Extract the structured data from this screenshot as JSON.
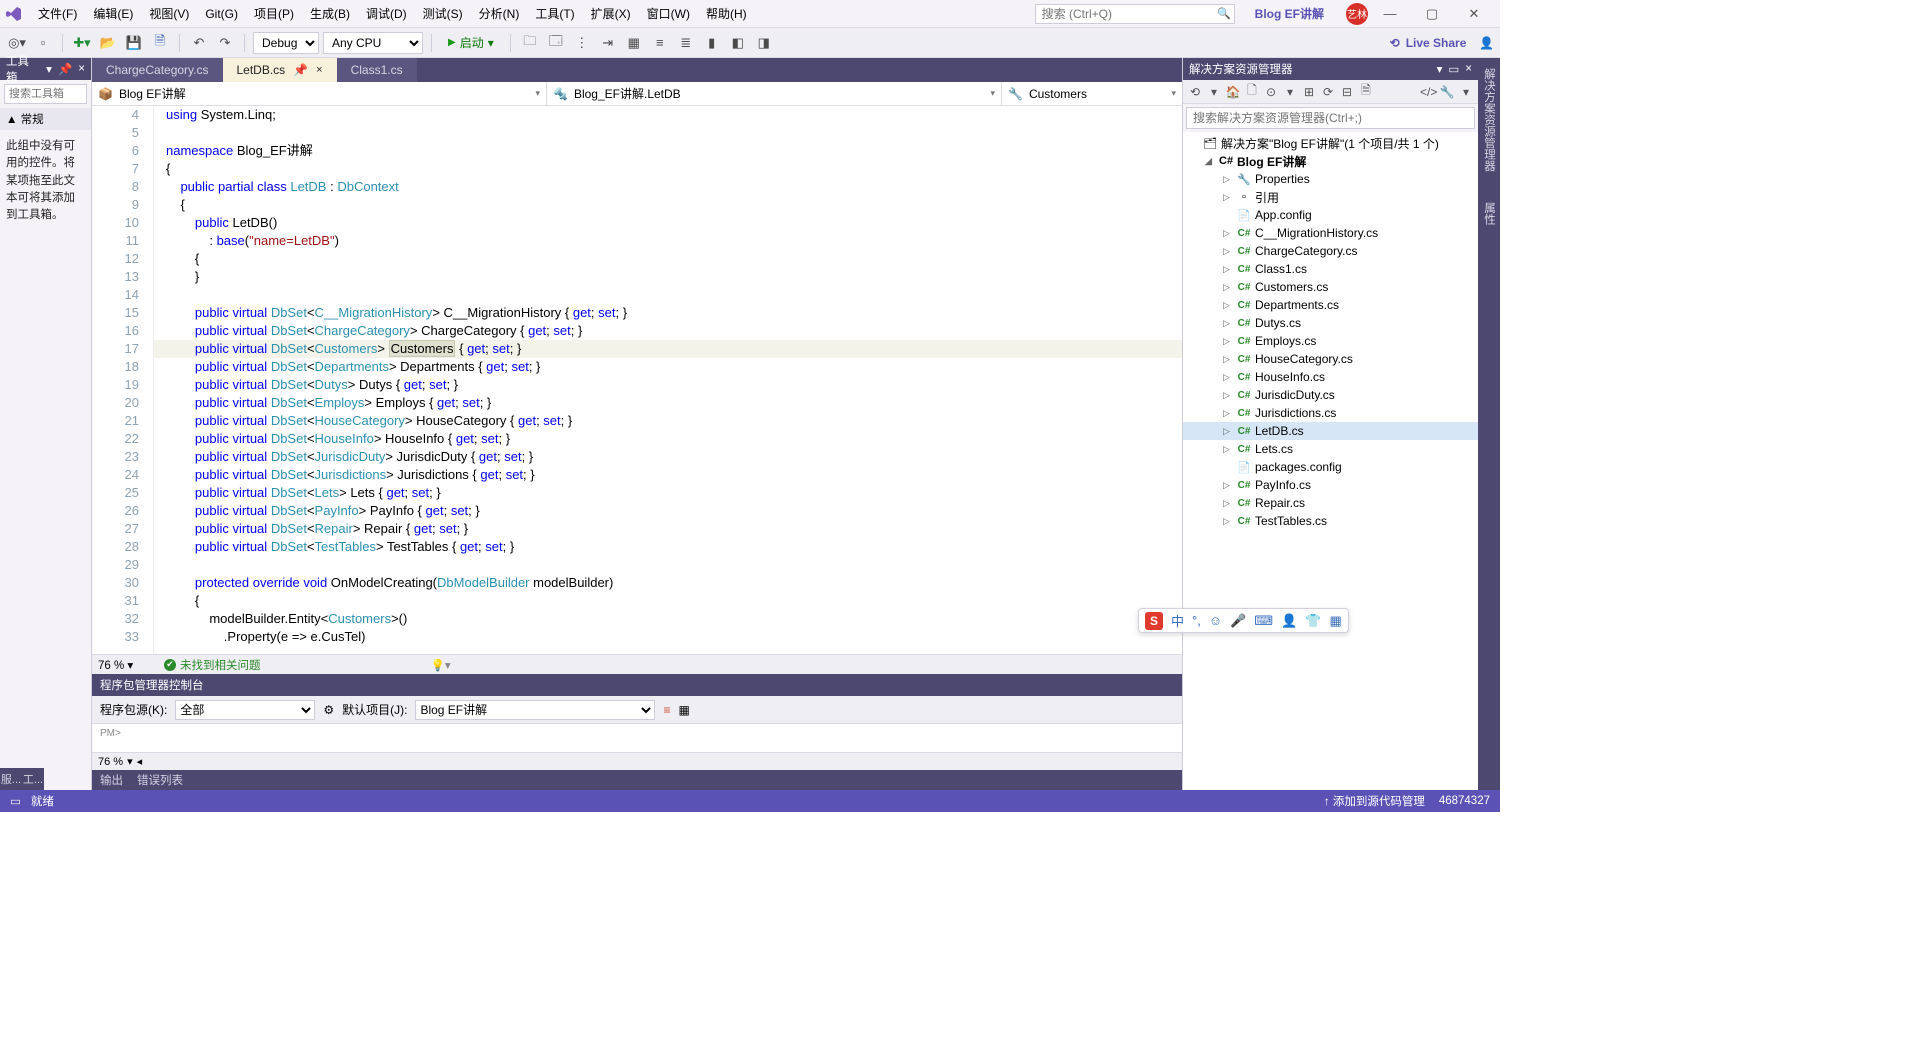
{
  "menu": {
    "items": [
      "文件(F)",
      "编辑(E)",
      "视图(V)",
      "Git(G)",
      "项目(P)",
      "生成(B)",
      "调试(D)",
      "测试(S)",
      "分析(N)",
      "工具(T)",
      "扩展(X)",
      "窗口(W)",
      "帮助(H)"
    ],
    "searchPlaceholder": "搜索 (Ctrl+Q)",
    "link": "Blog EF讲解",
    "avatar": "艺林"
  },
  "toolbar": {
    "config": "Debug",
    "platform": "Any CPU",
    "start": "启动",
    "liveshare": "Live Share"
  },
  "toolbox": {
    "title": "工具箱",
    "pin": "📌",
    "close": "×",
    "searchPlaceholder": "搜索工具箱",
    "cat": "▲ 常规",
    "msg": "此组中没有可用的控件。将某项拖至此文本可将其添加到工具箱。",
    "bottomTabs": [
      "服...",
      "工..."
    ]
  },
  "tabs": [
    {
      "label": "ChargeCategory.cs",
      "active": false
    },
    {
      "label": "LetDB.cs",
      "active": true
    },
    {
      "label": "Class1.cs",
      "active": false
    }
  ],
  "nav": {
    "left": "Blog EF讲解",
    "mid": "Blog_EF讲解.LetDB",
    "right": "Customers",
    "midIcon": "🔩",
    "rightIcon": "🔧"
  },
  "code": {
    "start": 4,
    "lines": [
      {
        "n": 4,
        "t": "using System.Linq;",
        "kw": [
          "using"
        ]
      },
      {
        "n": 5,
        "t": ""
      },
      {
        "n": 6,
        "t": "namespace Blog_EF讲解",
        "kw": [
          "namespace"
        ]
      },
      {
        "n": 7,
        "t": "{"
      },
      {
        "n": 8,
        "t": "    public partial class LetDB : DbContext",
        "kw": [
          "public",
          "partial",
          "class"
        ],
        "typ": [
          "LetDB",
          "DbContext"
        ]
      },
      {
        "n": 9,
        "t": "    {"
      },
      {
        "n": 10,
        "t": "        public LetDB()",
        "kw": [
          "public"
        ]
      },
      {
        "n": 11,
        "t": "            : base(\"name=LetDB\")",
        "kw": [
          "base"
        ],
        "str": [
          "\"name=LetDB\""
        ]
      },
      {
        "n": 12,
        "t": "        {"
      },
      {
        "n": 13,
        "t": "        }"
      },
      {
        "n": 14,
        "t": ""
      },
      {
        "n": 15,
        "t": "        public virtual DbSet<C__MigrationHistory> C__MigrationHistory { get; set; }",
        "kw": [
          "public",
          "virtual",
          "get",
          "set"
        ],
        "typ": [
          "DbSet",
          "C__MigrationHistory"
        ]
      },
      {
        "n": 16,
        "t": "        public virtual DbSet<ChargeCategory> ChargeCategory { get; set; }",
        "kw": [
          "public",
          "virtual",
          "get",
          "set"
        ],
        "typ": [
          "DbSet",
          "ChargeCategory"
        ]
      },
      {
        "n": 17,
        "t": "        public virtual DbSet<Customers> Customers { get; set; }",
        "kw": [
          "public",
          "virtual",
          "get",
          "set"
        ],
        "typ": [
          "DbSet",
          "Customers"
        ],
        "cur": true,
        "hl": "Customers"
      },
      {
        "n": 18,
        "t": "        public virtual DbSet<Departments> Departments { get; set; }",
        "kw": [
          "public",
          "virtual",
          "get",
          "set"
        ],
        "typ": [
          "DbSet",
          "Departments"
        ]
      },
      {
        "n": 19,
        "t": "        public virtual DbSet<Dutys> Dutys { get; set; }",
        "kw": [
          "public",
          "virtual",
          "get",
          "set"
        ],
        "typ": [
          "DbSet",
          "Dutys"
        ]
      },
      {
        "n": 20,
        "t": "        public virtual DbSet<Employs> Employs { get; set; }",
        "kw": [
          "public",
          "virtual",
          "get",
          "set"
        ],
        "typ": [
          "DbSet",
          "Employs"
        ]
      },
      {
        "n": 21,
        "t": "        public virtual DbSet<HouseCategory> HouseCategory { get; set; }",
        "kw": [
          "public",
          "virtual",
          "get",
          "set"
        ],
        "typ": [
          "DbSet",
          "HouseCategory"
        ]
      },
      {
        "n": 22,
        "t": "        public virtual DbSet<HouseInfo> HouseInfo { get; set; }",
        "kw": [
          "public",
          "virtual",
          "get",
          "set"
        ],
        "typ": [
          "DbSet",
          "HouseInfo"
        ]
      },
      {
        "n": 23,
        "t": "        public virtual DbSet<JurisdicDuty> JurisdicDuty { get; set; }",
        "kw": [
          "public",
          "virtual",
          "get",
          "set"
        ],
        "typ": [
          "DbSet",
          "JurisdicDuty"
        ]
      },
      {
        "n": 24,
        "t": "        public virtual DbSet<Jurisdictions> Jurisdictions { get; set; }",
        "kw": [
          "public",
          "virtual",
          "get",
          "set"
        ],
        "typ": [
          "DbSet",
          "Jurisdictions"
        ]
      },
      {
        "n": 25,
        "t": "        public virtual DbSet<Lets> Lets { get; set; }",
        "kw": [
          "public",
          "virtual",
          "get",
          "set"
        ],
        "typ": [
          "DbSet",
          "Lets"
        ]
      },
      {
        "n": 26,
        "t": "        public virtual DbSet<PayInfo> PayInfo { get; set; }",
        "kw": [
          "public",
          "virtual",
          "get",
          "set"
        ],
        "typ": [
          "DbSet",
          "PayInfo"
        ]
      },
      {
        "n": 27,
        "t": "        public virtual DbSet<Repair> Repair { get; set; }",
        "kw": [
          "public",
          "virtual",
          "get",
          "set"
        ],
        "typ": [
          "DbSet",
          "Repair"
        ]
      },
      {
        "n": 28,
        "t": "        public virtual DbSet<TestTables> TestTables { get; set; }",
        "kw": [
          "public",
          "virtual",
          "get",
          "set"
        ],
        "typ": [
          "DbSet",
          "TestTables"
        ]
      },
      {
        "n": 29,
        "t": ""
      },
      {
        "n": 30,
        "t": "        protected override void OnModelCreating(DbModelBuilder modelBuilder)",
        "kw": [
          "protected",
          "override",
          "void"
        ],
        "typ": [
          "DbModelBuilder"
        ]
      },
      {
        "n": 31,
        "t": "        {"
      },
      {
        "n": 32,
        "t": "            modelBuilder.Entity<Customers>()",
        "typ": [
          "Customers"
        ]
      },
      {
        "n": 33,
        "t": "                .Property(e => e.CusTel)"
      }
    ]
  },
  "edstatus": {
    "zoom": "76 %",
    "ok": "未找到相关问题"
  },
  "pkg": {
    "title": "程序包管理器控制台",
    "srcLabel": "程序包源(K):",
    "src": "全部",
    "projLabel": "默认项目(J):",
    "proj": "Blog EF讲解",
    "prompt": "PM>",
    "zoom": "76 %"
  },
  "bottomTabs": [
    "输出",
    "错误列表"
  ],
  "solexp": {
    "title": "解决方案资源管理器",
    "searchPlaceholder": "搜索解决方案资源管理器(Ctrl+;)",
    "root": "解决方案\"Blog EF讲解\"(1 个项目/共 1 个)",
    "project": "Blog EF讲解",
    "nodes": [
      {
        "i": "🔧",
        "t": "Properties"
      },
      {
        "i": "▫",
        "t": "引用"
      },
      {
        "i": "📄",
        "t": "App.config",
        "noar": true
      },
      {
        "i": "c#",
        "t": "C__MigrationHistory.cs"
      },
      {
        "i": "c#",
        "t": "ChargeCategory.cs"
      },
      {
        "i": "c#",
        "t": "Class1.cs"
      },
      {
        "i": "c#",
        "t": "Customers.cs"
      },
      {
        "i": "c#",
        "t": "Departments.cs"
      },
      {
        "i": "c#",
        "t": "Dutys.cs"
      },
      {
        "i": "c#",
        "t": "Employs.cs"
      },
      {
        "i": "c#",
        "t": "HouseCategory.cs"
      },
      {
        "i": "c#",
        "t": "HouseInfo.cs"
      },
      {
        "i": "c#",
        "t": "JurisdicDuty.cs"
      },
      {
        "i": "c#",
        "t": "Jurisdictions.cs"
      },
      {
        "i": "c#",
        "t": "LetDB.cs",
        "sel": true
      },
      {
        "i": "c#",
        "t": "Lets.cs"
      },
      {
        "i": "📄",
        "t": "packages.config",
        "noar": true
      },
      {
        "i": "c#",
        "t": "PayInfo.cs"
      },
      {
        "i": "c#",
        "t": "Repair.cs"
      },
      {
        "i": "c#",
        "t": "TestTables.cs"
      }
    ]
  },
  "vtabs": [
    "解决方案资源管理器",
    "属性"
  ],
  "status": {
    "ready": "就绪",
    "scm": "↑ 添加到源代码管理",
    "num": "46874327"
  },
  "ime": {
    "s": "S",
    "zh": "中"
  }
}
